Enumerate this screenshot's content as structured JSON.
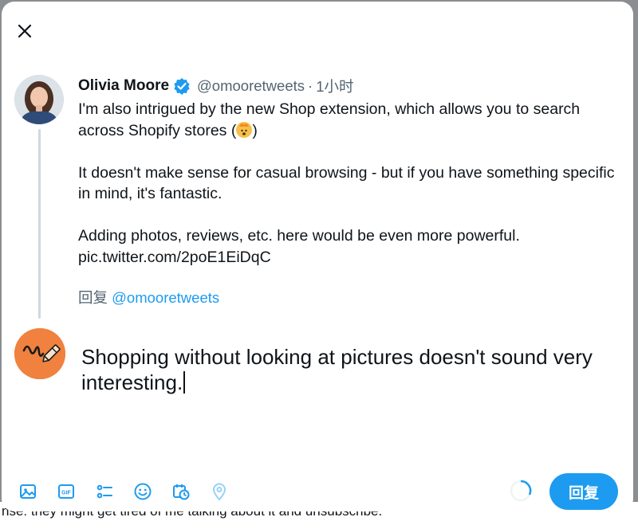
{
  "backdrop": {
    "text": "nse: they might get tired of me talking about it and unsubscribe."
  },
  "tweet": {
    "author_name": "Olivia Moore",
    "handle": "@omooretweets",
    "separator": "·",
    "time": "1小时",
    "para1_a": "I'm also intrigued by the new Shop extension, which allows you to search across Shopify stores (",
    "para1_b": ")",
    "para2": "It doesn't make sense for casual browsing - but if you have something specific in mind, it's fantastic.",
    "para3": "Adding photos, reviews, etc. here would be even more powerful.",
    "link": "pic.twitter.com/2poE1EiDqC",
    "emoji_icon": "exploding-head-emoji",
    "verified_icon": "verified-badge-icon"
  },
  "reply_to": {
    "prefix": "回复",
    "handle": "@omooretweets"
  },
  "compose": {
    "text": "Shopping without looking at pictures doesn't sound very interesting."
  },
  "toolbar": {
    "icons": [
      "image-icon",
      "gif-icon",
      "poll-icon",
      "emoji-icon",
      "schedule-icon",
      "location-icon"
    ],
    "reply_label": "回复"
  },
  "colors": {
    "accent": "#1d9bf0",
    "text": "#0f1419",
    "muted": "#536471",
    "avatar_bg": "#f0813e"
  }
}
